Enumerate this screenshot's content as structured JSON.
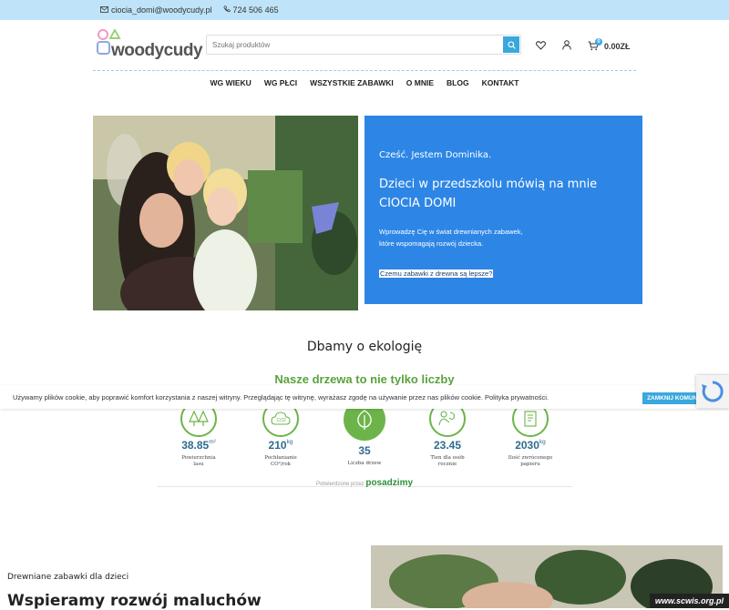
{
  "topbar": {
    "email": "ciocia_domi@woodycudy.pl",
    "phone": "724 506 465"
  },
  "logo": {
    "text": "woodycudy"
  },
  "search": {
    "placeholder": "Szukaj produktów"
  },
  "cart": {
    "count": "0",
    "total": "0.00ZŁ"
  },
  "nav": [
    "WG WIEKU",
    "WG PŁCI",
    "WSZYSTKIE ZABAWKI",
    "O MNIE",
    "BLOG",
    "KONTAKT"
  ],
  "hero": {
    "greeting": "Cześć. Jestem Dominika.",
    "headline_line1": "Dzieci w przedszkolu mówią na mnie",
    "headline_line2": "CIOCIA DOMI",
    "desc_line1": "Wprowadzę Cię w świat drewnianych zabawek,",
    "desc_line2": "które wspomagają rozwój dziecka.",
    "link": "Czemu zabawki z drewna są lepsze?"
  },
  "eco_title": "Dbamy o ekologię",
  "trees_title": "Nasze drzewa to nie tylko liczby",
  "cookie": {
    "text": "Używamy plików cookie, aby poprawić komfort korzystania z naszej witryny. Przeglądając tę witrynę, wyrażasz zgodę na używanie przez nas plików cookie. Polityka prywatności.",
    "button": "ZAMKNIJ KOMUNIKAT"
  },
  "stats": [
    {
      "value": "38.85",
      "unit": "m²",
      "label_line1": "Powierzchnia",
      "label_line2": "lasu"
    },
    {
      "value": "210",
      "unit": "kg",
      "label_line1": "Pochłanianie",
      "label_line2": "CO²/rok"
    },
    {
      "value": "35",
      "unit": "",
      "label_line1": "Liczba drzew",
      "label_line2": ""
    },
    {
      "value": "23.45",
      "unit": "",
      "label_line1": "Tlen dla osób",
      "label_line2": "rocznie"
    },
    {
      "value": "2030",
      "unit": "kg",
      "label_line1": "Ilość zwróconego",
      "label_line2": "papieru"
    }
  ],
  "verified": {
    "prefix": "Potwierdzone przez",
    "brand": "posadzimy"
  },
  "bottom": {
    "subtitle": "Drewniane zabawki dla dzieci",
    "title": "Wspieramy rozwój maluchów"
  },
  "watermark": "www.scwis.org.pl",
  "colors": {
    "accent": "#3aa8dd",
    "hero_blue": "#2d86e6",
    "green": "#5aa23b",
    "topbar": "#bfe3f8"
  }
}
